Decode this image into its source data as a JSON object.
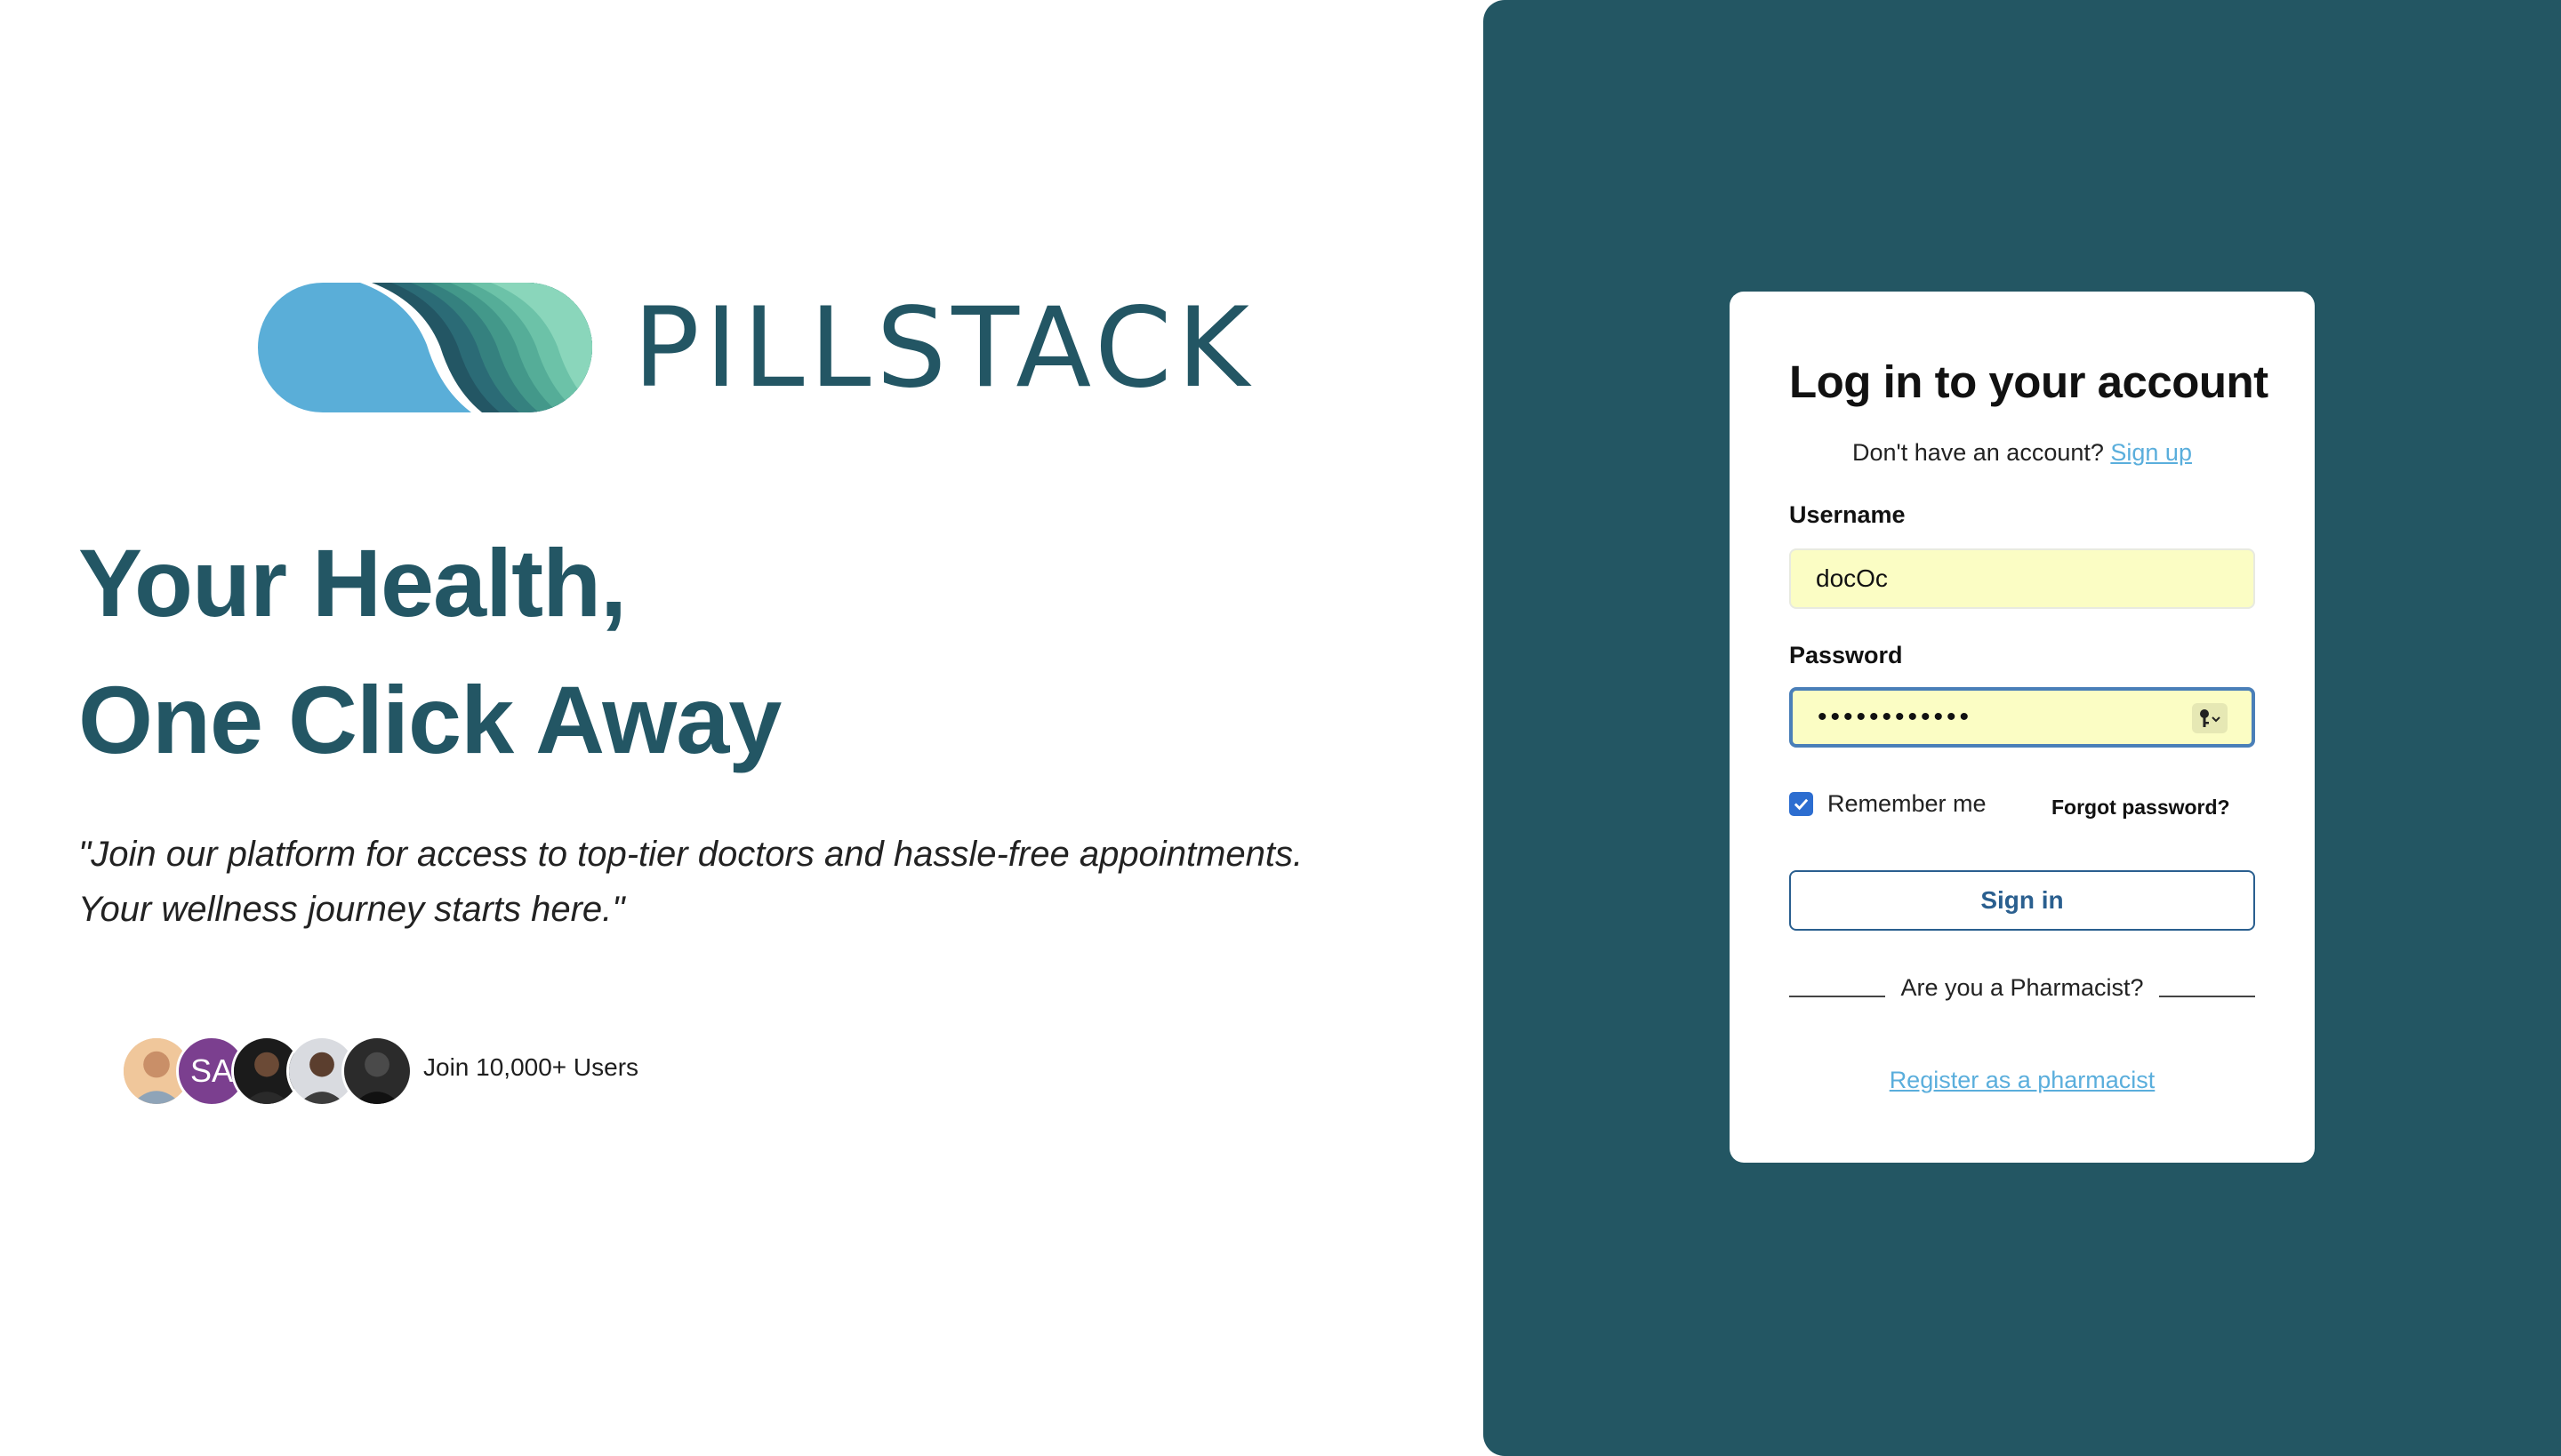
{
  "brand": {
    "name": "PILLSTACK",
    "logo_icon": "pill-wave-logo"
  },
  "hero": {
    "headline_line1": "Your Health,",
    "headline_line2": "One Click Away",
    "tagline_line1": "\"Join our platform for access to top-tier doctors and hassle-free appointments.",
    "tagline_line2": "Your wellness journey starts here.\"",
    "avatars": [
      "user-avatar-1",
      "SA",
      "user-avatar-3",
      "user-avatar-4",
      "user-avatar-5"
    ],
    "join_text": "Join 10,000+ Users"
  },
  "login": {
    "title": "Log in to your account",
    "no_account_text": "Don't have an account? ",
    "signup_link": "Sign up",
    "username_label": "Username",
    "username_value": "docOc",
    "password_label": "Password",
    "password_value": "••••••••••••",
    "password_manager_icon": "key-icon",
    "remember_label": "Remember me",
    "remember_checked": true,
    "forgot_label": "Forgot password?",
    "signin_label": "Sign in",
    "pharmacist_question": "Are you a Pharmacist?",
    "register_link": "Register as a pharmacist"
  },
  "colors": {
    "brand_teal": "#235664",
    "panel_bg": "#235663",
    "autofill_bg": "#fbfdc4",
    "link": "#5aaedc",
    "checkbox": "#2c6dd0"
  }
}
